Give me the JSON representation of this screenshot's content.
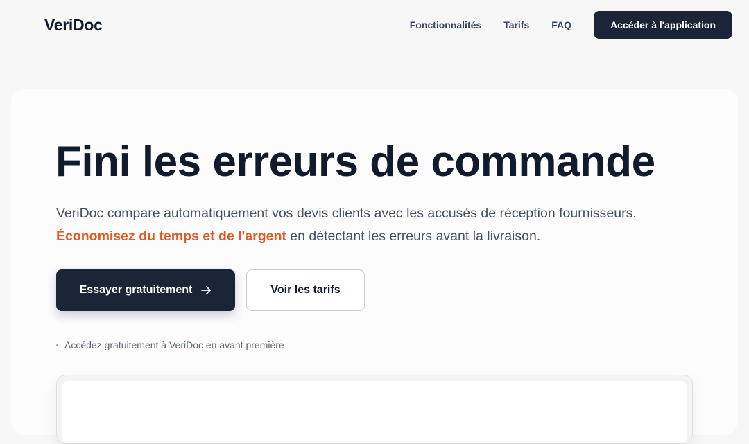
{
  "brand": {
    "name": "VeriDoc"
  },
  "nav": {
    "links": [
      "Fonctionnalités",
      "Tarifs",
      "FAQ"
    ],
    "app_button": "Accéder à l'application"
  },
  "hero": {
    "title": "Fini les erreurs de commande",
    "description_line1": "VeriDoc compare automatiquement vos devis clients avec les accusés de réception fournisseurs.",
    "highlight": "Économisez du temps et de l'argent",
    "description_line2_rest": " en détectant les erreurs avant la livraison.",
    "primary_cta": "Essayer gratuitement",
    "secondary_cta": "Voir les tarifs",
    "note": "Accédez gratuitement à VeriDoc en avant première"
  },
  "colors": {
    "accent": "#e05a24",
    "primary": "#1b2537",
    "background": "#f7f7f8"
  },
  "icons": {
    "cta_arrow": "arrow-right-icon"
  }
}
